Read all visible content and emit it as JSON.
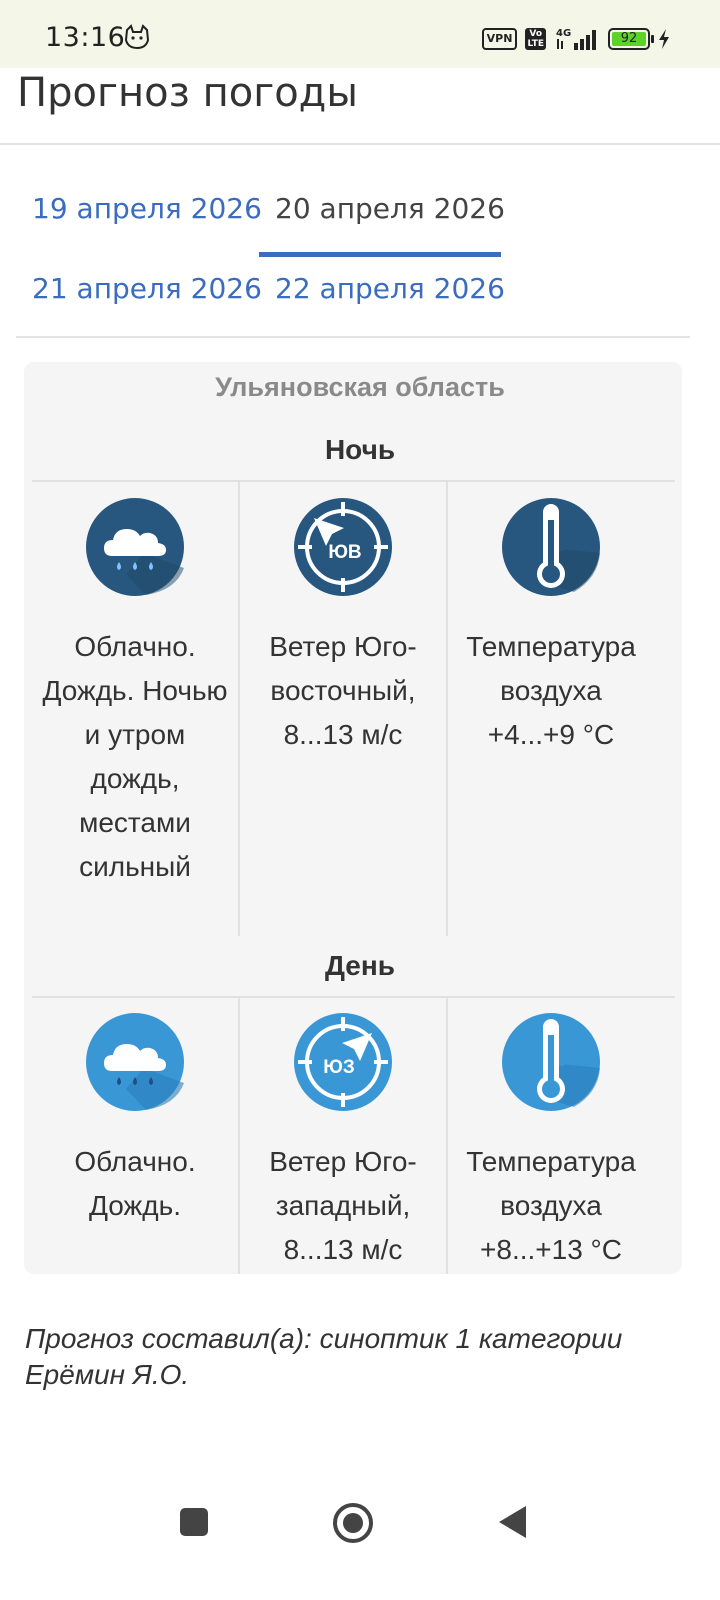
{
  "status_bar": {
    "time": "13:16",
    "vpn": "VPN",
    "volte": "Vo LTE",
    "network": "4G",
    "battery": "92"
  },
  "page": {
    "title": "Прогноз погоды"
  },
  "tabs": [
    {
      "label": "19 апреля 2026",
      "active": false
    },
    {
      "label": "20 апреля 2026",
      "active": true
    },
    {
      "label": "21 апреля 2026",
      "active": false
    },
    {
      "label": "22 апреля 2026",
      "active": false
    }
  ],
  "forecast": {
    "region": "Ульяновская область",
    "night": {
      "label": "Ночь",
      "sky": {
        "icon": "rain-cloud-icon",
        "text": "Облачно. Дождь. Ночью и утром дождь, местами сильный"
      },
      "wind": {
        "icon": "wind-direction-icon",
        "direction_code": "ЮВ",
        "text": "Ветер Юго-восточный, 8...13 м/с"
      },
      "temperature": {
        "icon": "thermometer-icon",
        "text": "Температура воздуха +4...+9 °C"
      }
    },
    "day": {
      "label": "День",
      "sky": {
        "icon": "rain-cloud-icon",
        "text": "Облачно. Дождь."
      },
      "wind": {
        "icon": "wind-direction-icon",
        "direction_code": "ЮЗ",
        "text": "Ветер Юго-западный, 8...13 м/с"
      },
      "temperature": {
        "icon": "thermometer-icon",
        "text": "Температура воздуха +8...+13 °C"
      }
    }
  },
  "colors": {
    "night_icon": "#27577f",
    "day_icon": "#3a97d6",
    "link": "#3a6cbf"
  },
  "footer": {
    "author": "Прогноз составил(а): синоптик 1 категории Ерёмин Я.О."
  },
  "nav": {
    "recents": "recents-icon",
    "home": "home-icon",
    "back": "back-icon"
  }
}
